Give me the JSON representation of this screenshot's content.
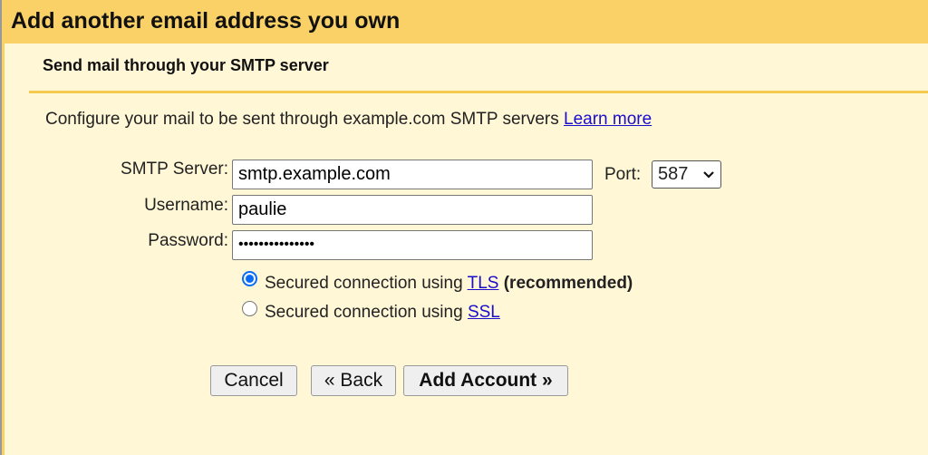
{
  "header": {
    "title": "Add another email address you own"
  },
  "section": {
    "title": "Send mail through your SMTP server"
  },
  "description": {
    "text": "Configure your mail to be sent through example.com SMTP servers ",
    "learn_more": "Learn more"
  },
  "form": {
    "smtp_label": "SMTP Server:",
    "smtp_value": "smtp.example.com",
    "port_label": "Port:",
    "port_value": "587",
    "username_label": "Username:",
    "username_value": "paulie",
    "password_label": "Password:",
    "password_value": "•••••••••••••••"
  },
  "security": {
    "tls": {
      "text": "Secured connection using ",
      "link": "TLS",
      "suffix": "(recommended)",
      "selected": true
    },
    "ssl": {
      "text": "Secured connection using ",
      "link": "SSL",
      "selected": false
    }
  },
  "buttons": {
    "cancel": "Cancel",
    "back": "« Back",
    "add": "Add Account »"
  },
  "colors": {
    "header": "#f9d166",
    "background": "#fff7d6",
    "link": "#1a0dcc",
    "radio_selected": "#0a6cf5"
  }
}
